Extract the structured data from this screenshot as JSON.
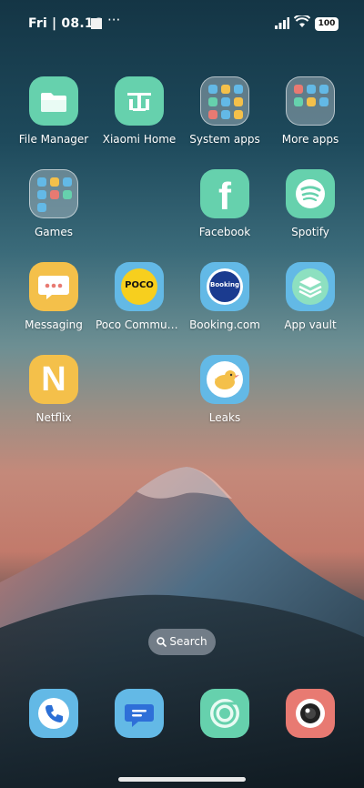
{
  "status_bar": {
    "time": "Fri | 08.16",
    "more": "···",
    "battery": "100"
  },
  "apps": {
    "file_manager": "File Manager",
    "xiaomi_home": "Xiaomi Home",
    "system_apps": "System apps",
    "more_apps": "More apps",
    "games": "Games",
    "facebook": "Facebook",
    "spotify": "Spotify",
    "messaging": "Messaging",
    "poco_community": "Poco Communi…",
    "booking": "Booking.com",
    "app_vault": "App vault",
    "netflix": "Netflix",
    "leaks": "Leaks"
  },
  "icon_text": {
    "poco": "POCO",
    "booking": "Booking",
    "netflix": "N",
    "facebook": "f"
  },
  "search": {
    "label": "Search"
  },
  "colors": {
    "mint": "#66d1ad",
    "blue": "#63b9e6",
    "yellow": "#f4c04a",
    "red": "#e87a72"
  }
}
